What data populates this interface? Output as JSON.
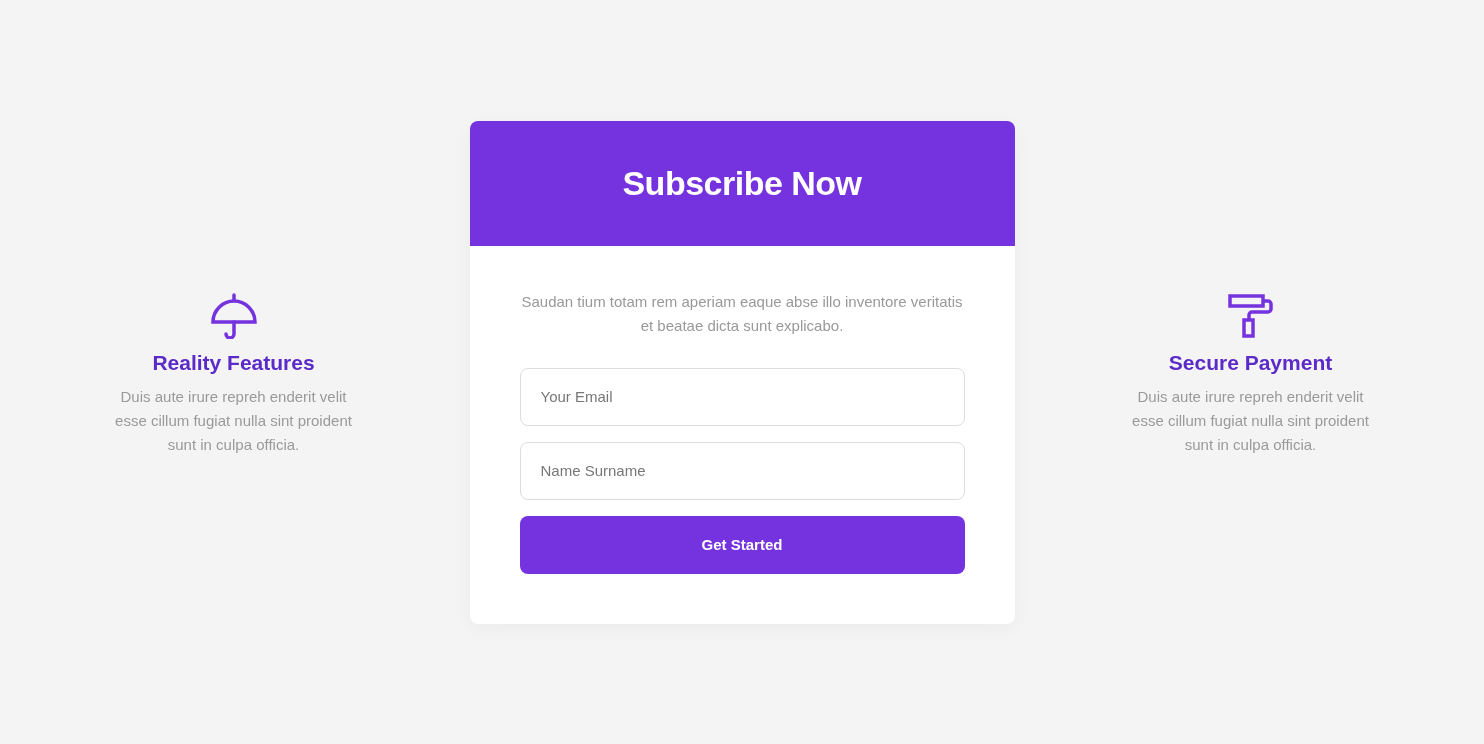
{
  "features": [
    {
      "title": "Reality Features",
      "text": "Duis aute irure repreh enderit velit esse cillum fugiat nulla sint proident sunt in culpa officia."
    },
    {
      "title": "Secure Payment",
      "text": "Duis aute irure repreh enderit velit esse cillum fugiat nulla sint proident sunt in culpa officia."
    }
  ],
  "card": {
    "title": "Subscribe Now",
    "text": "Saudan tium totam rem aperiam eaque abse illo inventore veritatis et beatae dicta sunt explicabo.",
    "fields": [
      {
        "placeholder": "Your Email"
      },
      {
        "placeholder": "Name Surname"
      }
    ],
    "button": "Get Started"
  }
}
